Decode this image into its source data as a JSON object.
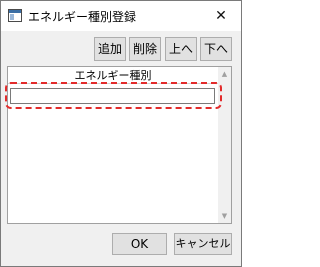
{
  "window": {
    "title": "エネルギー種別登録",
    "close_glyph": "✕"
  },
  "toolbar": {
    "add_label": "追加",
    "delete_label": "削除",
    "up_label": "上へ",
    "down_label": "下へ"
  },
  "list": {
    "column_header": "エネルギー種別",
    "rows": [
      {
        "value": ""
      }
    ],
    "scroll_up_glyph": "▲",
    "scroll_down_glyph": "▼"
  },
  "footer": {
    "ok_label": "OK",
    "cancel_label": "キャンセル"
  },
  "annotation": {
    "color": "#e22b2b",
    "style": "dashed"
  }
}
